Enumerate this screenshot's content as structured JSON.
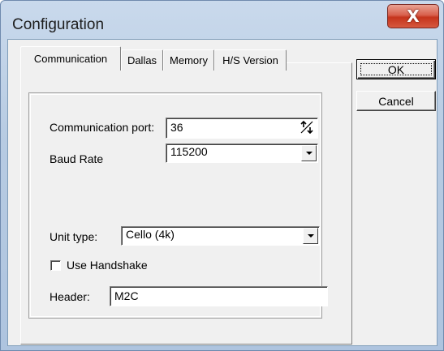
{
  "window": {
    "title": "Configuration",
    "close_label": "X"
  },
  "tabs": [
    {
      "label": "Communication",
      "active": true
    },
    {
      "label": "Dallas",
      "active": false
    },
    {
      "label": "Memory",
      "active": false
    },
    {
      "label": "H/S Version",
      "active": false
    }
  ],
  "buttons": {
    "ok": "OK",
    "cancel": "Cancel"
  },
  "form": {
    "comm_port": {
      "label": "Communication port:",
      "value": "36"
    },
    "baud_rate": {
      "label": "Baud Rate",
      "value": "115200"
    },
    "unit_type": {
      "label": "Unit type:",
      "value": "Cello (4k)"
    },
    "handshake": {
      "label": "Use Handshake",
      "checked": false
    },
    "header": {
      "label": "Header:",
      "value": "M2C"
    }
  },
  "colors": {
    "dialog_bg": "#f0f0f0",
    "titlebar": "#b7cbe2",
    "close_button": "#c5341c"
  },
  "icons": {
    "close": "close-icon",
    "spinner": "spin-arrows-icon",
    "dropdown": "chevron-down-icon"
  }
}
